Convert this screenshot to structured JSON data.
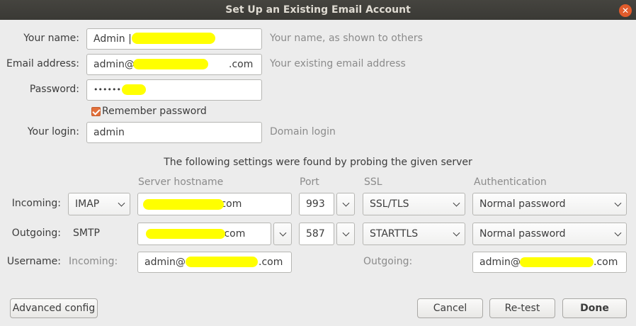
{
  "window": {
    "title": "Set Up an Existing Email Account"
  },
  "form": {
    "name_label": "Your name:",
    "name_value": "Admin |",
    "name_hint": "Your name, as shown to others",
    "email_label": "Email address:",
    "email_value": "admin@",
    "email_value_end": ".com",
    "email_hint": "Your existing email address",
    "password_label": "Password:",
    "password_value": "••••••••",
    "remember_label": "Remember password",
    "login_label": "Your login:",
    "login_value": "admin",
    "login_hint": "Domain login"
  },
  "settings": {
    "caption": "The following settings were found by probing the given server",
    "headers": {
      "hostname": "Server hostname",
      "port": "Port",
      "ssl": "SSL",
      "auth": "Authentication"
    },
    "incoming": {
      "label": "Incoming:",
      "protocol": "IMAP",
      "host_end": ".com",
      "port": "993",
      "ssl": "SSL/TLS",
      "auth": "Normal password"
    },
    "outgoing": {
      "label": "Outgoing:",
      "protocol": "SMTP",
      "host_end": ".com",
      "port": "587",
      "ssl": "STARTTLS",
      "auth": "Normal password"
    },
    "username": {
      "label": "Username:",
      "incoming_label": "Incoming:",
      "incoming_value": "admin@",
      "incoming_end": ".com",
      "outgoing_label": "Outgoing:",
      "outgoing_value": "admin@",
      "outgoing_end": ".com"
    }
  },
  "buttons": {
    "advanced": "Advanced config",
    "cancel": "Cancel",
    "retest": "Re-test",
    "done": "Done"
  },
  "colors": {
    "accent": "#e2703b",
    "redaction": "#ffff00"
  }
}
